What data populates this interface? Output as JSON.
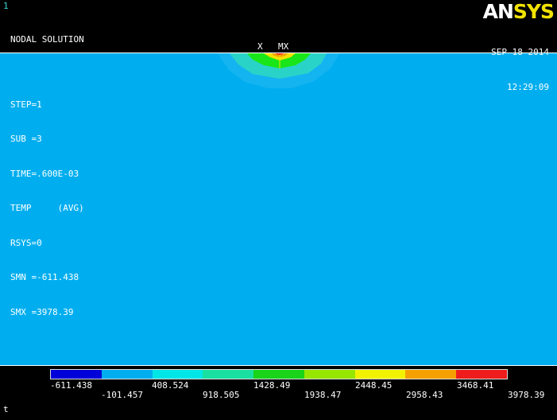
{
  "window": {
    "number": "1"
  },
  "logo": {
    "part1": "AN",
    "part2": "SYS"
  },
  "info": {
    "title": "NODAL SOLUTION",
    "lines": [
      "STEP=1",
      "SUB =3",
      "TIME=.600E-03",
      "TEMP     (AVG)",
      "RSYS=0",
      "SMN =-611.438",
      "SMX =3978.39"
    ]
  },
  "date": {
    "date": "SEP 18 2014",
    "time": "12:29:09"
  },
  "plot": {
    "axis_label": "X",
    "marker_label": "MX",
    "colors": {
      "background": "#00aeef",
      "band1": "#2ad3c8",
      "band2": "#19e619",
      "band3": "#f2e200",
      "band4": "#f4a000",
      "band5": "#ee1c1c"
    }
  },
  "legend": {
    "colors": [
      "#0000d8",
      "#00aeef",
      "#00e6e6",
      "#19e0a0",
      "#19d419",
      "#96e600",
      "#f2f200",
      "#f4a000",
      "#ee1c1c"
    ],
    "labels_top": [
      "-611.438",
      "408.524",
      "1428.49",
      "2448.45",
      "3468.41"
    ],
    "labels_bottom": [
      "-101.457",
      "918.505",
      "1938.47",
      "2958.43",
      "3978.39"
    ]
  },
  "bottom": {
    "text": "t"
  }
}
